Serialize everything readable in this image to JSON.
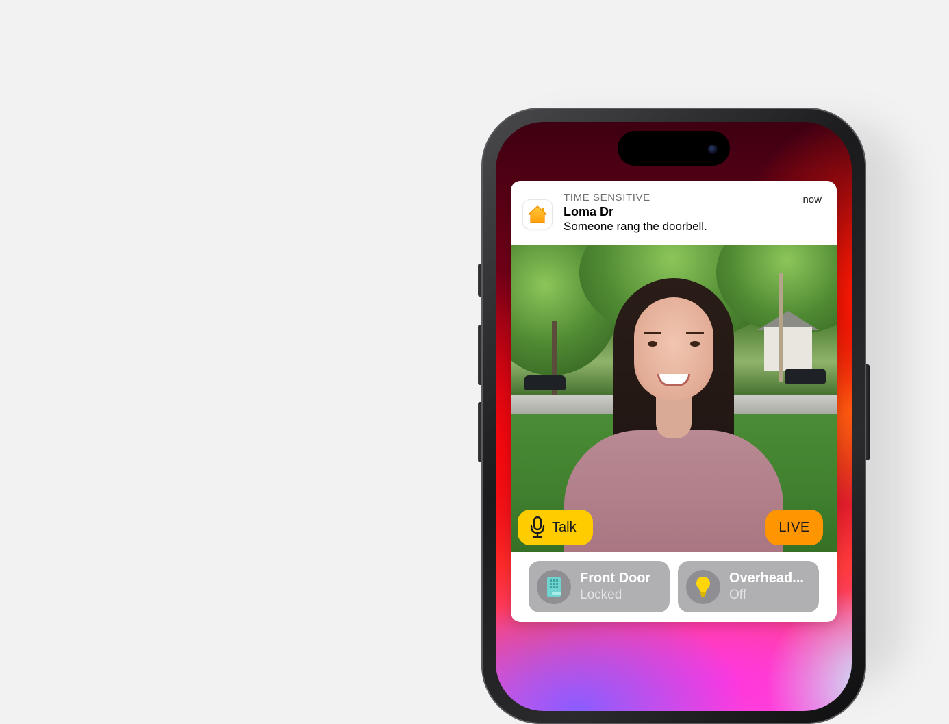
{
  "notification": {
    "label": "TIME SENSITIVE",
    "title": "Loma Dr",
    "body": "Someone rang the doorbell.",
    "time": "now",
    "app_icon": "home-app-icon"
  },
  "camera": {
    "talk_label": "Talk",
    "talk_icon": "microphone-icon",
    "live_label": "LIVE"
  },
  "accessories": [
    {
      "name": "Front Door",
      "state": "Locked",
      "icon": "lock-keypad-icon"
    },
    {
      "name": "Overhead...",
      "state": "Off",
      "icon": "lightbulb-icon"
    }
  ],
  "colors": {
    "talk_button": "#ffcc00",
    "live_badge": "#ff9500",
    "home_icon": "#ffb300",
    "tile_background": "#b0b0b3"
  }
}
